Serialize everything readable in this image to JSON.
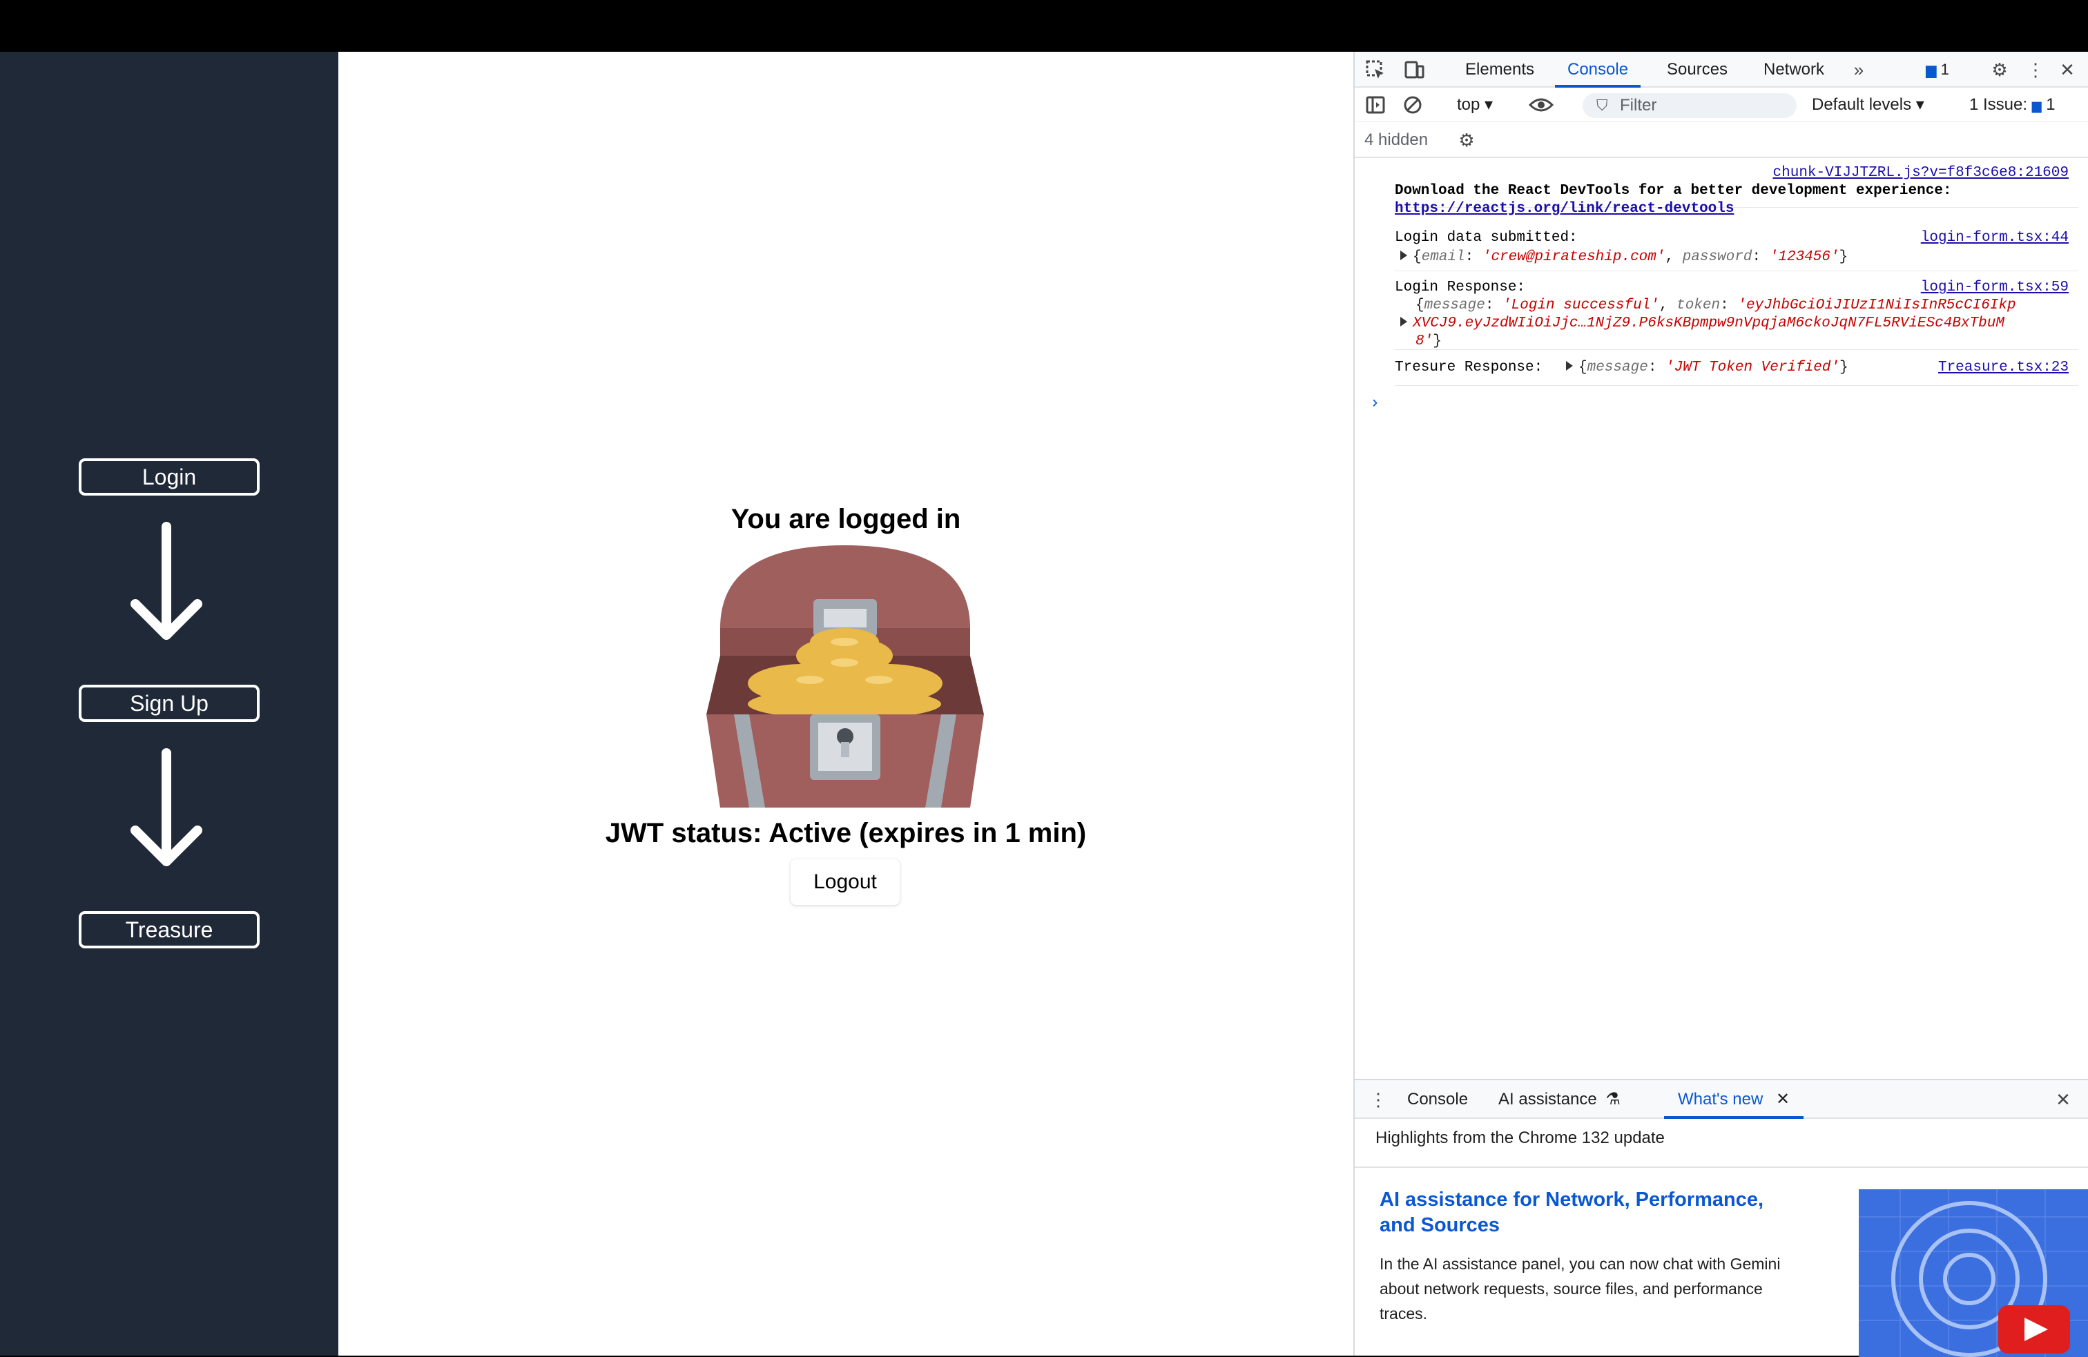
{
  "sidebar": {
    "login_label": "Login",
    "signup_label": "Sign Up",
    "treasure_label": "Treasure"
  },
  "main": {
    "title": "You are logged in",
    "jwt_status": "JWT status: Active (expires in 1 min)",
    "logout_label": "Logout"
  },
  "devtools": {
    "tabs": [
      "Elements",
      "Console",
      "Sources",
      "Network"
    ],
    "issues_badge": "1",
    "context": "top",
    "filter_placeholder": "Filter",
    "levels": "Default levels",
    "issues_label": "1 Issue:",
    "issues_count": "1",
    "hidden": "4 hidden",
    "logs": {
      "react": {
        "source": "chunk-VIJJTZRL.js?v=f8f3c6e8:21609",
        "message": "Download the React DevTools for a better development experience:",
        "link": "https://reactjs.org/link/react-devtools"
      },
      "login_data": {
        "label": "Login data submitted:",
        "source": "login-form.tsx:44",
        "k_email": "email",
        "v_email": "'crew@pirateship.com'",
        "k_password": "password",
        "v_password": "'123456'"
      },
      "login_response": {
        "label": "Login Response:",
        "source": "login-form.tsx:59",
        "k_message": "message",
        "v_message": "'Login successful'",
        "k_token": "token",
        "v_token_1": "'eyJhbGciOiJIUzI1NiIsInR5cCI6Ikp",
        "v_token_2": "XVCJ9.eyJzdWIiOiJjc…1NjZ9.P6ksKBpmpw9nVpqjaM6ckoJqN7FL5RViESc4BxTbuM",
        "v_token_3": "8'"
      },
      "treasure_response": {
        "label": "Tresure Response:",
        "source": "Treasure.tsx:23",
        "k_message": "message",
        "v_message": "'JWT Token Verified'"
      }
    },
    "drawer": {
      "tabs": [
        "Console",
        "AI assistance",
        "What's new"
      ],
      "highlights": "Highlights from the Chrome 132 update",
      "ai_title": "AI assistance for Network, Performance, and Sources",
      "ai_desc": "In the AI assistance panel, you can now chat with Gemini about network requests, source files, and performance traces."
    }
  },
  "colors": {
    "sidebar_bg": "#1f2937",
    "accent": "#0b57d0",
    "string_red": "#c80000"
  }
}
